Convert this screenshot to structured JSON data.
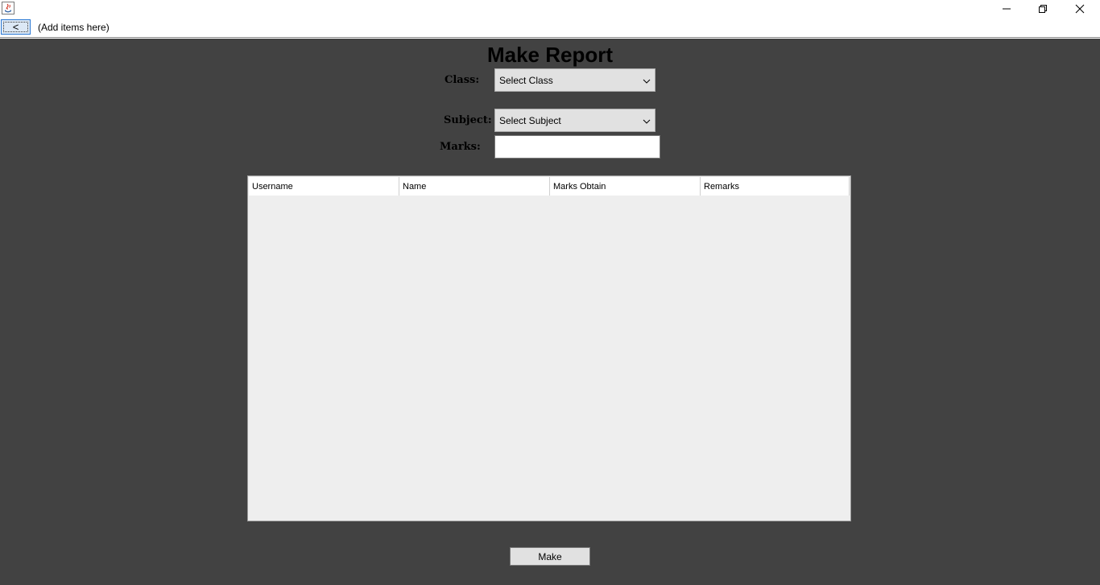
{
  "window": {
    "icon": "java-cup-icon",
    "controls": [
      "minimize-icon",
      "restore-icon",
      "close-icon"
    ]
  },
  "menubar": {
    "back_label": "<",
    "placeholder": "(Add items here)"
  },
  "form": {
    "title": "Make Report",
    "class_label": "Class:",
    "class_value": "Select Class",
    "subject_label": "Subject:",
    "subject_value": "Select Subject",
    "marks_label": "Marks:",
    "marks_value": ""
  },
  "table": {
    "columns": [
      "Username",
      "Name",
      "Marks Obtain",
      "Remarks"
    ],
    "rows": []
  },
  "actions": {
    "make_label": "Make"
  },
  "colors": {
    "panel_bg": "#424242",
    "table_bg": "#eeeeee",
    "focus_border": "#2a78d4"
  }
}
